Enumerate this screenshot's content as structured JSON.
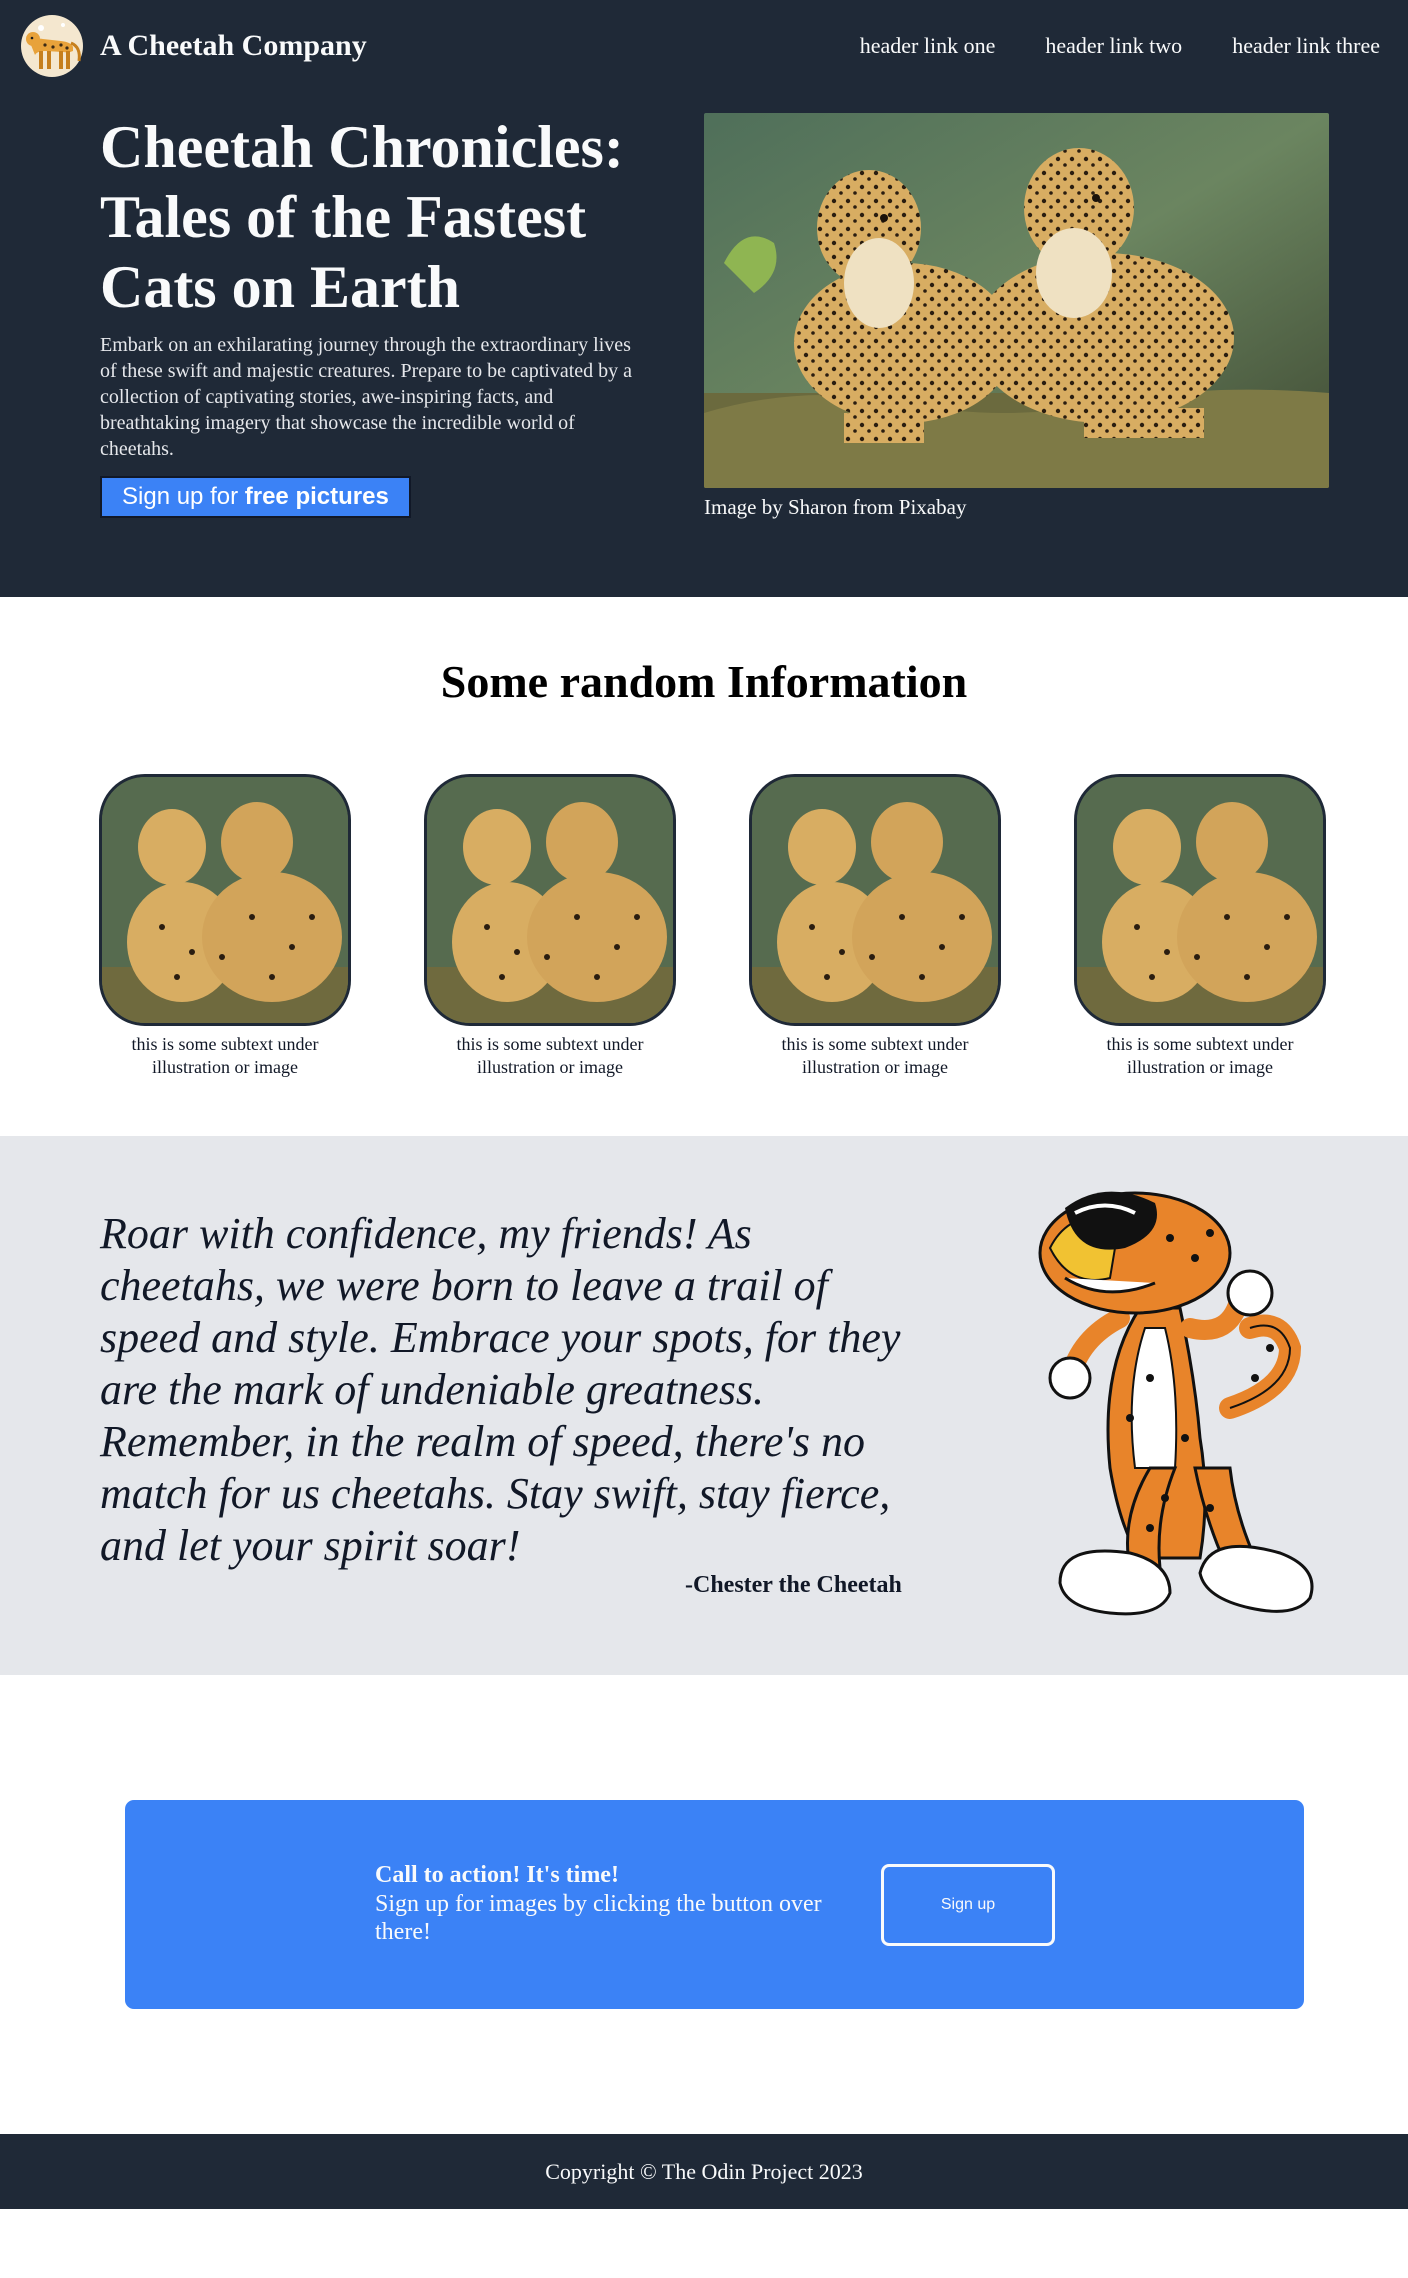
{
  "header": {
    "brand_name": "A Cheetah Company",
    "nav": [
      "header link one",
      "header link two",
      "header link three"
    ]
  },
  "hero": {
    "title": "Cheetah Chronicles: Tales of the Fastest Cats on Earth",
    "text": "Embark on an exhilarating journey through the extraordinary lives of these swift and majestic creatures. Prepare to be captivated by a collection of captivating stories, awe-inspiring facts, and breathtaking imagery that showcase the incredible world of cheetahs.",
    "button_prefix": "Sign up for ",
    "button_bold": "free pictures",
    "image_caption": "Image by Sharon from Pixabay"
  },
  "info": {
    "title": "Some random Information",
    "cards": [
      {
        "caption": "this is some subtext under illustration or image"
      },
      {
        "caption": "this is some subtext under illustration or image"
      },
      {
        "caption": "this is some subtext under illustration or image"
      },
      {
        "caption": "this is some subtext under illustration or image"
      }
    ]
  },
  "quote": {
    "text": "Roar with confidence, my friends! As cheetahs, we were born to leave a trail of speed and style. Embrace your spots, for they are the mark of undeniable greatness. Remember, in the realm of speed, there's no match for us cheetahs. Stay swift, stay fierce, and let your spirit soar!",
    "author": "-Chester the Cheetah"
  },
  "cta": {
    "title": "Call to action! It's time!",
    "text": "Sign up for images by clicking the button over there!",
    "button_label": "Sign up"
  },
  "footer": {
    "copyright": "Copyright © The Odin Project 2023"
  },
  "colors": {
    "dark": "#1f2937",
    "accent": "#3b82f6",
    "light_gray": "#e5e7eb"
  }
}
